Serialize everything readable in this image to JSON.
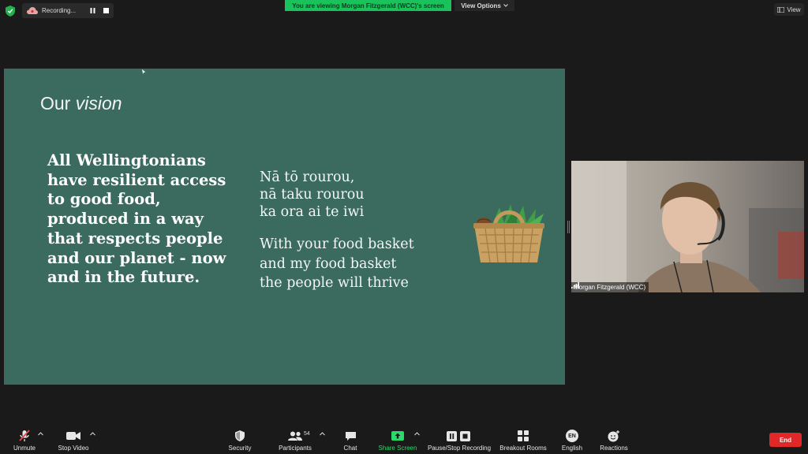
{
  "top_bar": {
    "recording_label": "Recording...",
    "viewing_banner": "You are viewing Morgan Fitzgerald (WCC)'s screen",
    "view_options_label": "View Options",
    "view_label": "View"
  },
  "slide": {
    "title_plain": "Our ",
    "title_italic": "vision",
    "vision_statement": "All Wellingtonians have resilient access to good food, produced in a way that respects people and our planet - now and in the future.",
    "maori_lines": [
      "Nā tō rourou,",
      "nā taku rourou",
      "ka ora ai te iwi"
    ],
    "english_lines": [
      "With your food basket",
      "and my food basket",
      "the people will thrive"
    ]
  },
  "participant": {
    "name": "Morgan Fitzgerald (WCC)"
  },
  "toolbar": {
    "unmute": "Unmute",
    "stop_video": "Stop Video",
    "security": "Security",
    "participants": "Participants",
    "participants_count": "54",
    "chat": "Chat",
    "share_screen": "Share Screen",
    "pause_stop_recording": "Pause/Stop Recording",
    "breakout_rooms": "Breakout Rooms",
    "english": "English",
    "language_code": "EN",
    "reactions": "Reactions",
    "end": "End"
  },
  "colors": {
    "slide_background": "#3a6b5e",
    "share_green": "#19c25b",
    "end_red": "#e02828",
    "unmute_red": "#e5484d"
  }
}
